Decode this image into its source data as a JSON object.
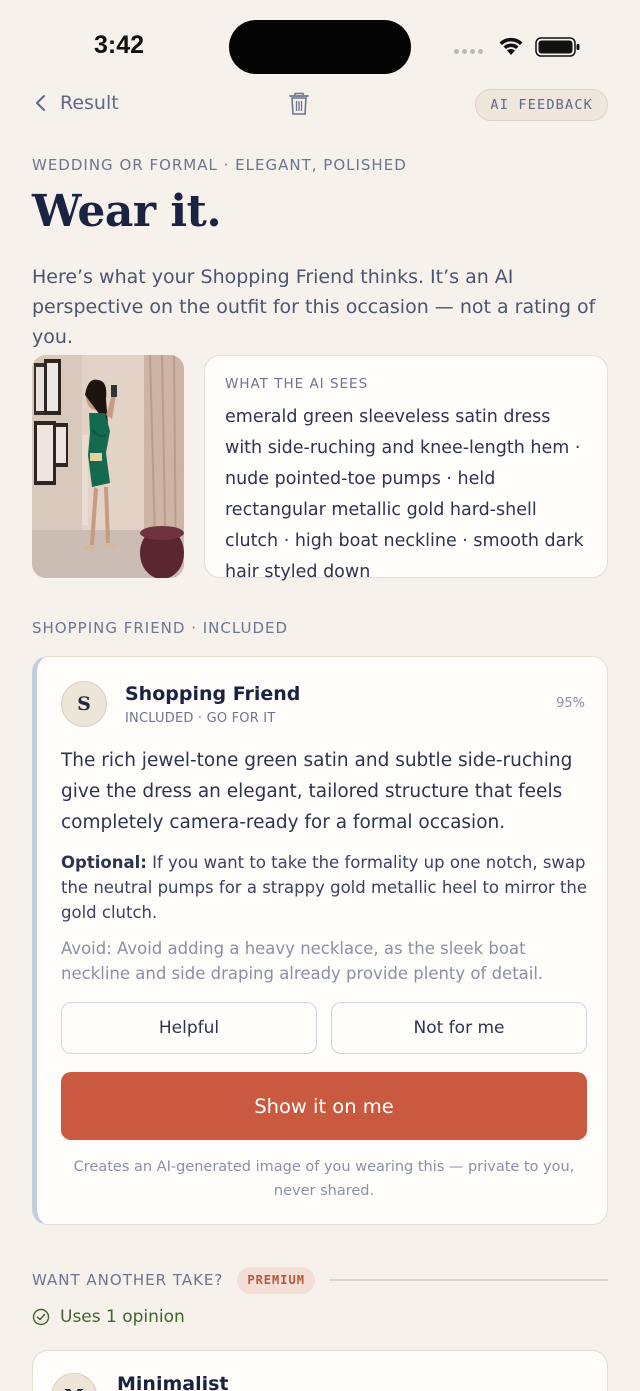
{
  "status_bar": {
    "time": "3:42"
  },
  "nav": {
    "back_label": "Result",
    "feedback_label": "AI FEEDBACK"
  },
  "occasion_eyebrow": "WEDDING OR FORMAL · ELEGANT, POLISHED",
  "title": "Wear it.",
  "intro": "Here’s what your Shopping Friend thinks. It’s an AI perspective on the outfit for this occasion — not a rating of you.",
  "ai_sees": {
    "label": "WHAT THE AI SEES",
    "text": "emerald green sleeveless satin dress with side-ruching and knee-length hem · nude pointed-toe pumps · held rectangular metallic gold hard-shell clutch · high boat neckline · smooth dark hair styled down"
  },
  "section_label": "SHOPPING FRIEND · INCLUDED",
  "friend": {
    "initial": "S",
    "name": "Shopping Friend",
    "subtitle": "INCLUDED · GO FOR IT",
    "confidence": "95%",
    "body": "The rich jewel-tone green satin and subtle side-ruching give the dress an elegant, tailored structure that feels completely camera-ready for a formal occasion.",
    "optional_label": "Optional:",
    "optional_text": "If you want to take the formality up one notch, swap the neutral pumps for a strappy gold metallic heel to mirror the gold clutch.",
    "avoid": "Avoid: Avoid adding a heavy necklace, as the sleek boat neckline and side draping already provide plenty of detail.",
    "helpful_label": "Helpful",
    "not_for_me_label": "Not for me",
    "show_label": "Show it on me",
    "disclaimer": "Creates an AI-generated image of you wearing this — private to you, never shared."
  },
  "another_take": {
    "label": "WANT ANOTHER TAKE?",
    "badge": "PREMIUM",
    "uses": "Uses 1 opinion"
  },
  "minimalist": {
    "initial": "M",
    "name": "Minimalist",
    "confidence": ""
  },
  "colors": {
    "accent": "#c95a3f",
    "background": "#f6f1eb",
    "ink": "#1a2442",
    "success": "#3f6430"
  }
}
